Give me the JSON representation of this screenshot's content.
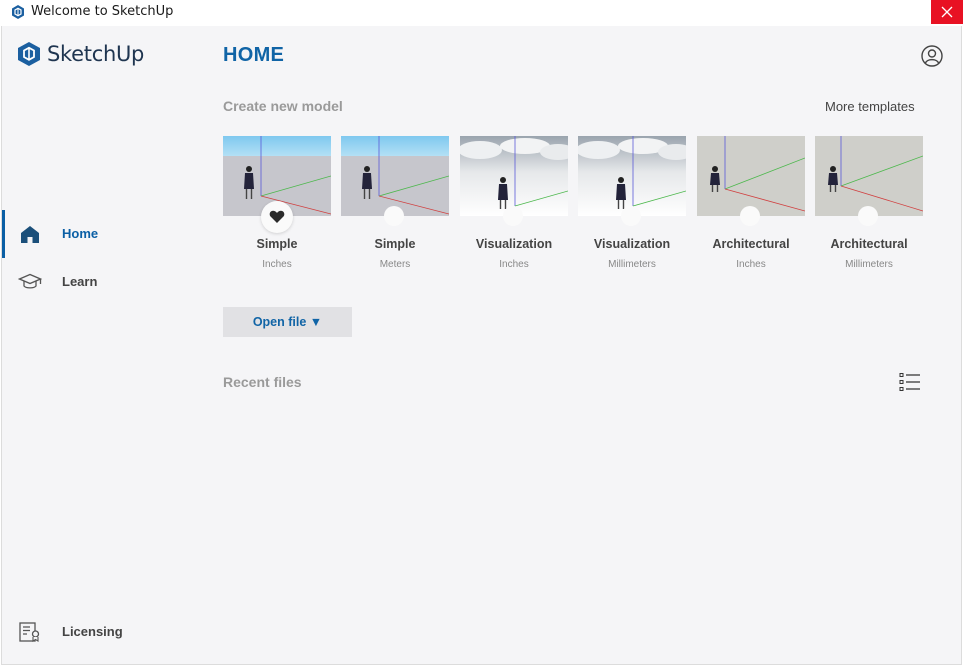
{
  "window": {
    "title": "Welcome to SketchUp",
    "close_icon": "close-icon",
    "app_icon": "sketchup-logo-icon"
  },
  "sidebar": {
    "logo_text": "SketchUp",
    "items": [
      {
        "label": "Home",
        "icon": "home-icon",
        "active": true
      },
      {
        "label": "Learn",
        "icon": "graduation-cap-icon",
        "active": false
      }
    ],
    "licensing": {
      "label": "Licensing",
      "icon": "license-icon"
    }
  },
  "header": {
    "title": "HOME",
    "account_icon": "user-circle-icon"
  },
  "create": {
    "title": "Create new model",
    "more_templates": "More templates",
    "templates": [
      {
        "name": "Simple",
        "unit": "Inches",
        "favorite": true,
        "style": "sky"
      },
      {
        "name": "Simple",
        "unit": "Meters",
        "favorite": false,
        "style": "sky"
      },
      {
        "name": "Visualization",
        "unit": "Inches",
        "favorite": false,
        "style": "clouds"
      },
      {
        "name": "Visualization",
        "unit": "Millimeters",
        "favorite": false,
        "style": "clouds"
      },
      {
        "name": "Architectural",
        "unit": "Inches",
        "favorite": false,
        "style": "plain"
      },
      {
        "name": "Architectural",
        "unit": "Millimeters",
        "favorite": false,
        "style": "plain"
      }
    ]
  },
  "open_file": {
    "label": "Open file ▼"
  },
  "recent": {
    "title": "Recent files",
    "view_icon": "list-view-icon"
  },
  "colors": {
    "accent": "#1064a6",
    "close_red": "#e81123",
    "background": "#f5f5f7"
  }
}
